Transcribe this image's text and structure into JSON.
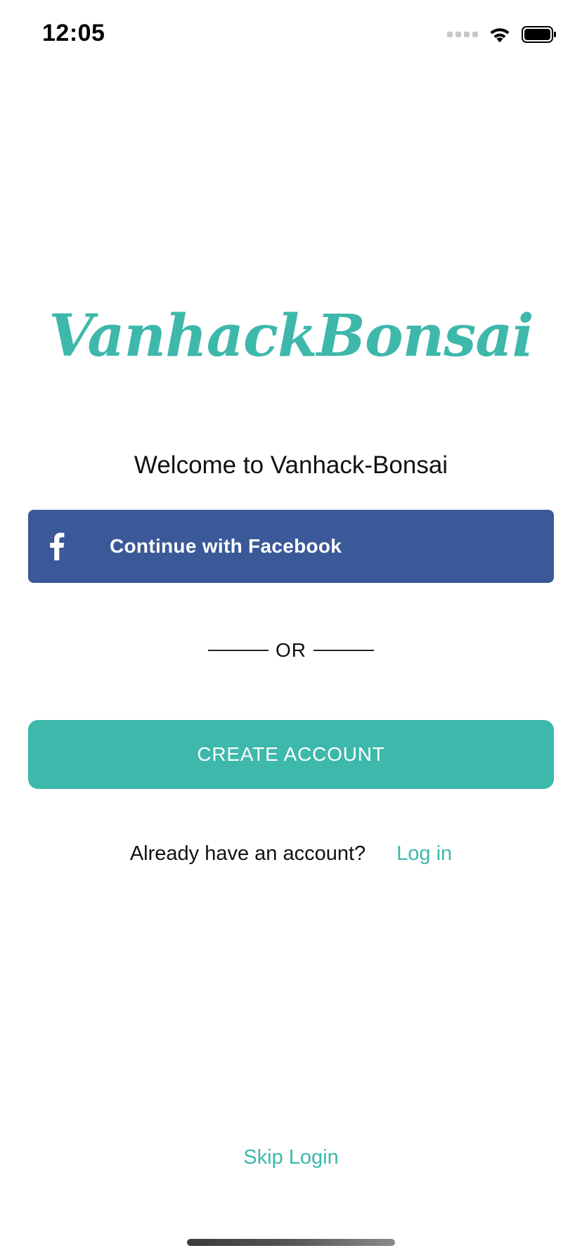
{
  "status_bar": {
    "time": "12:05",
    "icons": [
      "signal-dots-icon",
      "wifi-icon",
      "battery-icon"
    ]
  },
  "logo": {
    "text": "VanhackBonsai",
    "color": "#3db8ab"
  },
  "welcome": {
    "text": "Welcome to Vanhack-Bonsai"
  },
  "facebook_button": {
    "label": "Continue with Facebook",
    "icon": "facebook-icon",
    "color": "#3b5998"
  },
  "divider": {
    "text": "OR"
  },
  "create_account_button": {
    "label": "CREATE ACCOUNT",
    "color": "#3db8ab"
  },
  "login": {
    "prompt": "Already have an account?",
    "link": "Log in"
  },
  "skip_login": {
    "label": "Skip Login"
  },
  "colors": {
    "accent": "#3db8ab",
    "facebook": "#3b5998",
    "text": "#111111",
    "background": "#ffffff"
  }
}
